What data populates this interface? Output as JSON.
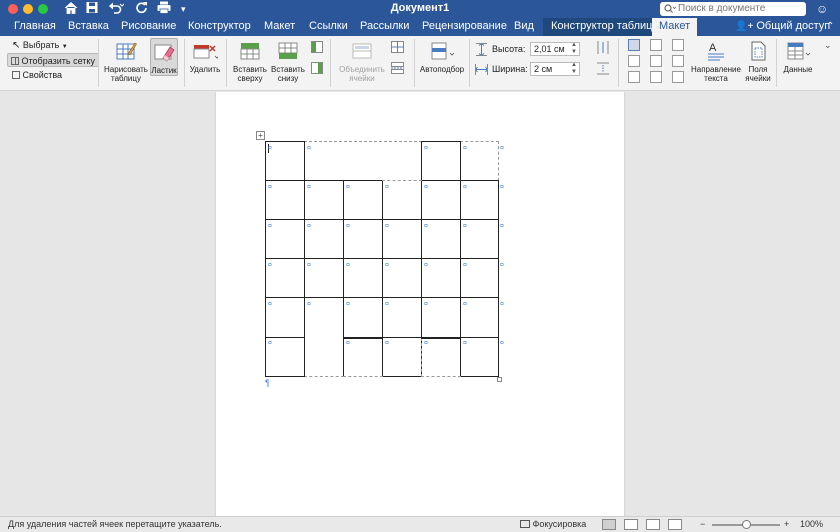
{
  "window": {
    "title": "Документ1",
    "search_placeholder": "Поиск в документе",
    "share_label": "Общий доступ"
  },
  "tabs": [
    {
      "label": "Главная"
    },
    {
      "label": "Вставка"
    },
    {
      "label": "Рисование"
    },
    {
      "label": "Конструктор"
    },
    {
      "label": "Макет"
    },
    {
      "label": "Ссылки"
    },
    {
      "label": "Рассылки"
    },
    {
      "label": "Рецензирование"
    },
    {
      "label": "Вид"
    },
    {
      "label": "Конструктор таблиц"
    },
    {
      "label": "Макет"
    }
  ],
  "ribbon": {
    "select_label": "Выбрать",
    "grid_label": "Отобразить сетку",
    "properties_label": "Свойства",
    "draw_table_label_1": "Нарисовать",
    "draw_table_label_2": "таблицу",
    "eraser_label": "Ластик",
    "delete_label": "Удалить",
    "insert_above_label_1": "Вставить",
    "insert_above_label_2": "сверху",
    "insert_below_label_1": "Вставить",
    "insert_below_label_2": "снизу",
    "merge_label_1": "Объединить",
    "merge_label_2": "ячейки",
    "autofit_label": "Автоподбор",
    "height_label": "Высота:",
    "height_value": "2,01 см",
    "width_label": "Ширина:",
    "width_value": "2 см",
    "text_direction_label_1": "Направление",
    "text_direction_label_2": "текста",
    "cell_margins_label_1": "Поля",
    "cell_margins_label_2": "ячейки",
    "data_label": "Данные"
  },
  "status": {
    "message": "Для удаления частей ячеек перетащите указатель.",
    "focus_label": "Фокусировка",
    "zoom": "100%",
    "zoom_fraction": 0.5
  }
}
